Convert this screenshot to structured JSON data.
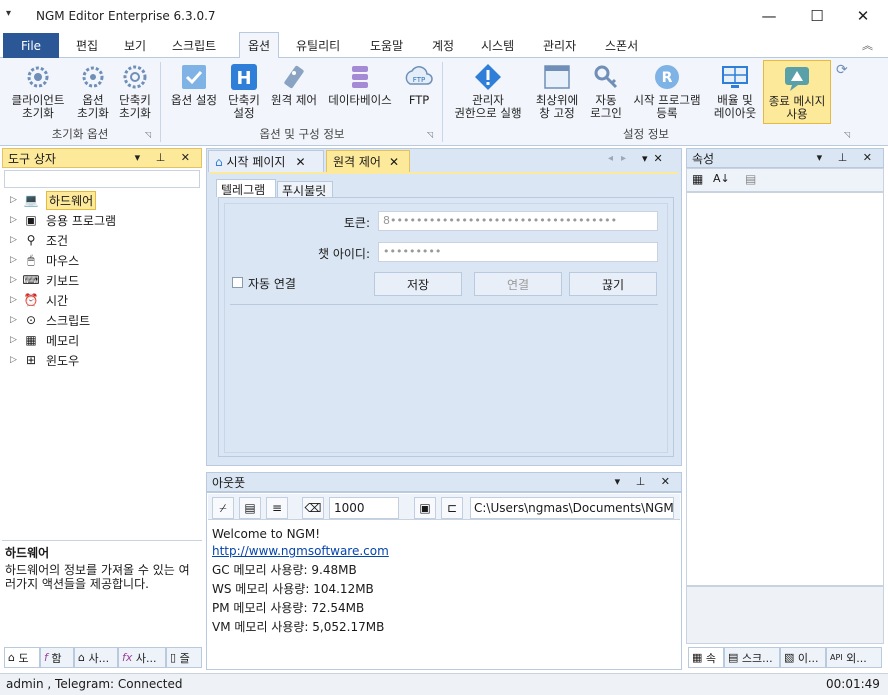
{
  "window": {
    "app_title": "NGM Editor",
    "edition": "Enterprise 6.3.0.7",
    "minimize": "—",
    "maximize": "☐",
    "close": "✕"
  },
  "ribbon_tabs": [
    "File",
    "편집",
    "보기",
    "스크립트",
    "옵션",
    "유틸리티",
    "도움말",
    "계정",
    "시스템",
    "관리자",
    "스폰서"
  ],
  "ribbon_active_tab": "옵션",
  "ribbon_groups": {
    "reset": {
      "label": "초기화 옵션",
      "buttons": [
        {
          "line1": "클라이언트",
          "line2": "초기화",
          "icon": "gears-icon"
        },
        {
          "line1": "옵션",
          "line2": "초기화",
          "icon": "gear-icon"
        },
        {
          "line1": "단축키",
          "line2": "초기화",
          "icon": "gear-icon"
        }
      ]
    },
    "config": {
      "label": "옵션 및 구성 정보",
      "buttons": [
        {
          "line1": "옵션 설정",
          "line2": "",
          "icon": "checkbox-icon"
        },
        {
          "line1": "단축키",
          "line2": "설정",
          "icon": "hotkey-icon"
        },
        {
          "line1": "원격 제어",
          "line2": "",
          "icon": "remote-icon"
        },
        {
          "line1": "데이타베이스",
          "line2": "",
          "icon": "database-icon"
        },
        {
          "line1": "FTP",
          "line2": "",
          "icon": "ftp-icon"
        }
      ]
    },
    "settings": {
      "label": "설정 정보",
      "buttons": [
        {
          "line1": "관리자",
          "line2": "권한으로 실행",
          "icon": "warning-icon"
        },
        {
          "line1": "최상위에",
          "line2": "창 고정",
          "icon": "window-icon"
        },
        {
          "line1": "자동",
          "line2": "로그인",
          "icon": "key-icon"
        },
        {
          "line1": "시작 프로그램",
          "line2": "등록",
          "icon": "r-icon"
        },
        {
          "line1": "배율 및",
          "line2": "레이아웃",
          "icon": "layout-icon"
        },
        {
          "line1": "종료 메시지",
          "line2": "사용",
          "icon": "message-icon"
        }
      ]
    }
  },
  "toolbox": {
    "title": "도구 상자",
    "items": [
      {
        "label": "하드웨어",
        "icon": "laptop-icon",
        "glyph": "💻"
      },
      {
        "label": "응용 프로그램",
        "icon": "app-icon",
        "glyph": "▣"
      },
      {
        "label": "조건",
        "icon": "condition-icon",
        "glyph": "⚲"
      },
      {
        "label": "마우스",
        "icon": "mouse-icon",
        "glyph": "🖱"
      },
      {
        "label": "키보드",
        "icon": "keyboard-icon",
        "glyph": "⌨"
      },
      {
        "label": "시간",
        "icon": "clock-icon",
        "glyph": "⏰"
      },
      {
        "label": "스크립트",
        "icon": "script-icon",
        "glyph": "⊙"
      },
      {
        "label": "메모리",
        "icon": "memory-icon",
        "glyph": "▦"
      },
      {
        "label": "윈도우",
        "icon": "windows-icon",
        "glyph": "⊞"
      }
    ],
    "desc_title": "하드웨어",
    "desc_body": "하드웨어의 정보를 가져올 수 있는 여러가지 액션들을 제공합니다.",
    "bottom_tabs": [
      "도",
      "함",
      "사...",
      "사...",
      "즐"
    ]
  },
  "doc_tabs": [
    "시작 페이지",
    "원격 제어"
  ],
  "remote": {
    "subtabs": [
      "텔레그램",
      "푸시불릿"
    ],
    "token_label": "토큰:",
    "token_value": "8•••••••••••••••••••••••••••••••••••",
    "chatid_label": "챗 아이디:",
    "chatid_value": "•••••••••",
    "autoconnect_label": "자동 연결",
    "save_label": "저장",
    "connect_label": "연결",
    "disconnect_label": "끊기"
  },
  "output": {
    "title": "아웃풋",
    "font_size": "1000",
    "path": "C:\\Users\\ngmas\\Documents\\NGM6\\",
    "lines": [
      "Welcome to NGM!",
      "http://www.ngmsoftware.com",
      "GC 메모리 사용량: 9.48MB",
      "WS 메모리 사용량: 104.12MB",
      "PM 메모리 사용량: 72.54MB",
      "VM 메모리 사용량: 5,052.17MB"
    ]
  },
  "properties": {
    "title": "속성",
    "bottom_tabs": [
      "속",
      "스크...",
      "이...",
      "외..."
    ]
  },
  "status": {
    "left": "admin  , Telegram: Connected",
    "time": "00:01:49"
  },
  "colors": {
    "accent": "#2b5797",
    "highlight": "#fde99a",
    "link": "#0645ad"
  }
}
